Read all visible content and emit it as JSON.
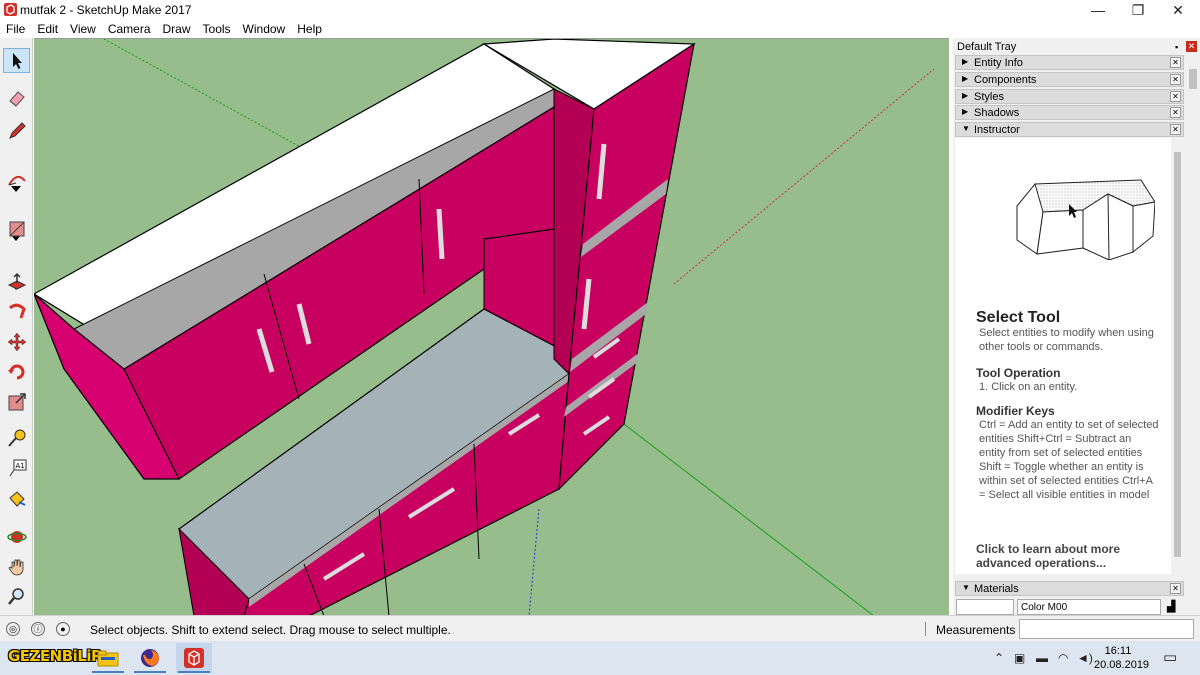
{
  "window": {
    "title": "mutfak 2 - SketchUp Make 2017",
    "minimize_glyph": "—",
    "maximize_glyph": "❐",
    "close_glyph": "✕"
  },
  "menu": [
    "File",
    "Edit",
    "View",
    "Camera",
    "Draw",
    "Tools",
    "Window",
    "Help"
  ],
  "toolbar": {
    "tools": [
      "select-tool",
      "eraser-tool",
      "pencil-line-tool",
      "arc-tool",
      "rectangle-tool",
      "push-pull-tool",
      "follow-me-tool",
      "move-tool",
      "rotate-tool",
      "scale-tool",
      "tape-measure-tool",
      "text-tool",
      "paint-bucket-tool",
      "orbit-tool",
      "pan-tool",
      "zoom-tool"
    ],
    "active": "select-tool",
    "text_tool_glyph": "A1"
  },
  "colors": {
    "viewport_bg": "#97bd8d",
    "cabinet_magenta": "#c8005f",
    "cabinet_dark": "#9a0048",
    "counter_gray": "#a5b2b8",
    "trim_gray": "#a7a7a7",
    "axis_green": "#18a018",
    "axis_red": "#cc3333",
    "axis_blue": "#3333cc"
  },
  "tray": {
    "title": "Default Tray",
    "pin_glyph": "📌",
    "close_glyph": "✕",
    "panel_close_glyph": "✕",
    "caret_collapsed": "▶",
    "caret_expanded": "▼",
    "panels": [
      {
        "label": "Entity Info",
        "expanded": false
      },
      {
        "label": "Components",
        "expanded": false
      },
      {
        "label": "Styles",
        "expanded": false
      },
      {
        "label": "Shadows",
        "expanded": false
      },
      {
        "label": "Instructor",
        "expanded": true
      }
    ],
    "instructor": {
      "heading": "Select Tool",
      "description": "Select entities to modify when using other tools or commands.",
      "operation_heading": "Tool Operation",
      "operation_steps": "1. Click on an entity.",
      "modifier_heading": "Modifier Keys",
      "modifier_text": "Ctrl = Add an entity to set of selected entities Shift+Ctrl = Subtract an entity from set of selected entities Shift = Toggle whether an entity is within set of selected entities Ctrl+A = Select all visible entities in model",
      "learn_more": "Click to learn about more advanced operations..."
    },
    "materials": {
      "label": "Materials",
      "current": "Color M00"
    }
  },
  "statusbar": {
    "hint": "Select objects. Shift to extend select. Drag mouse to select multiple.",
    "measurements_label": "Measurements",
    "measurements_value": ""
  },
  "taskbar": {
    "brand": "GEZENBiLiR",
    "apps": [
      "file-explorer",
      "firefox",
      "sketchup"
    ],
    "time": "16:11",
    "date": "20.08.2019"
  }
}
